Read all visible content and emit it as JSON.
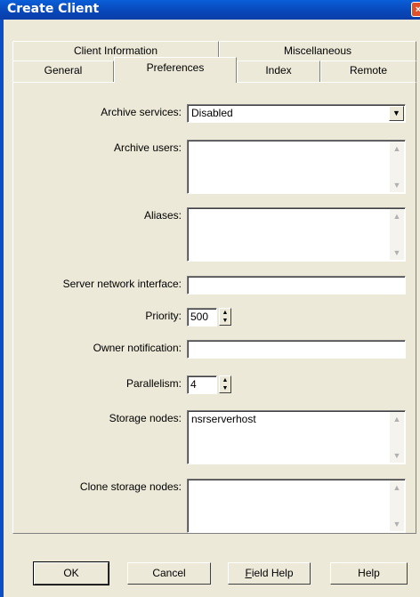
{
  "window": {
    "title": "Create Client",
    "close_symbol": "×"
  },
  "tabs": {
    "row1": [
      {
        "label": "Client Information"
      },
      {
        "label": "Miscellaneous"
      }
    ],
    "row2": [
      {
        "label": "General"
      },
      {
        "label": "Preferences",
        "active": true
      },
      {
        "label": "Index"
      },
      {
        "label": "Remote"
      }
    ]
  },
  "form": {
    "archive_services": {
      "label": "Archive services:",
      "value": "Disabled"
    },
    "archive_users": {
      "label": "Archive users:",
      "value": ""
    },
    "aliases": {
      "label": "Aliases:",
      "value": ""
    },
    "server_network_interface": {
      "label": "Server network interface:",
      "value": ""
    },
    "priority": {
      "label": "Priority:",
      "value": "500"
    },
    "owner_notification": {
      "label": "Owner notification:",
      "value": ""
    },
    "parallelism": {
      "label": "Parallelism:",
      "value": "4"
    },
    "storage_nodes": {
      "label": "Storage nodes:",
      "value": "nsrserverhost"
    },
    "clone_storage_nodes": {
      "label": "Clone storage nodes:",
      "value": ""
    }
  },
  "buttons": {
    "ok": "OK",
    "cancel": "Cancel",
    "field_help_mnemonic": "F",
    "field_help_rest": "ield Help",
    "help": "Help"
  },
  "icons": {
    "dropdown": "chevron-down-icon",
    "scroll_up": "scroll-up-arrow-icon",
    "scroll_down": "scroll-down-arrow-icon",
    "spin_up": "spin-up-icon",
    "spin_down": "spin-down-icon",
    "close": "close-icon"
  },
  "colors": {
    "title_bar": "#0846b8",
    "dialog_bg": "#ece9d8",
    "close_button": "#e0502c"
  }
}
